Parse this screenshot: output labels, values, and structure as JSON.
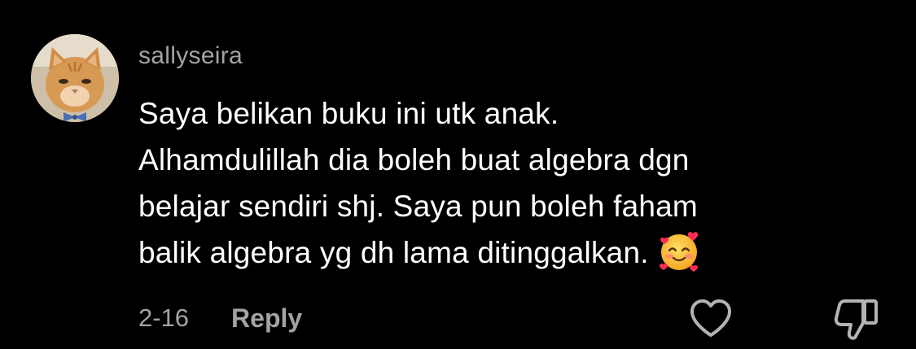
{
  "comment": {
    "username": "sallyseira",
    "avatar_icon": "cat-avatar",
    "text_lines": [
      "Saya belikan buku ini utk anak.",
      "Alhamdulillah dia boleh buat algebra dgn",
      "belajar sendiri shj. Saya pun boleh faham",
      "balik algebra yg dh lama ditinggalkan."
    ],
    "emoji": "smiling-face-with-hearts",
    "date": "2-16",
    "reply_label": "Reply",
    "like_icon": "heart-outline-icon",
    "dislike_icon": "thumbs-down-outline-icon"
  },
  "colors": {
    "background": "#000000",
    "primary_text": "#ffffff",
    "secondary_text": "#a3a3a3"
  }
}
